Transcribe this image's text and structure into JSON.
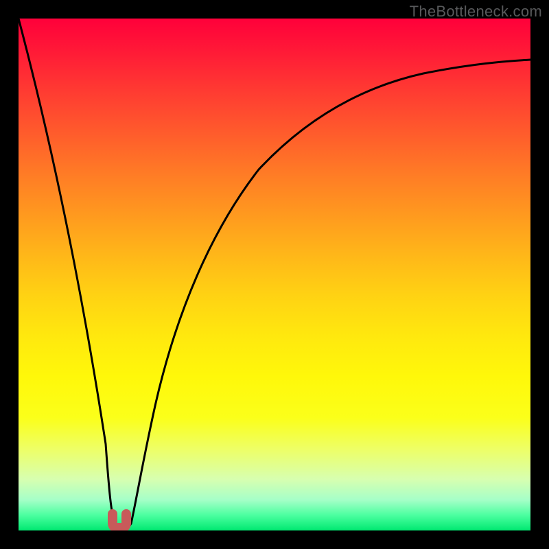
{
  "watermark": "TheBottleneck.com",
  "chart_data": {
    "type": "line",
    "title": "",
    "xlabel": "",
    "ylabel": "",
    "xlim": [
      0,
      100
    ],
    "ylim": [
      0,
      100
    ],
    "series": [
      {
        "name": "bottleneck-curve",
        "x": [
          0,
          2,
          4,
          6,
          8,
          10,
          12,
          14,
          16,
          17,
          18,
          19,
          20,
          21,
          22,
          23,
          24,
          26,
          28,
          30,
          35,
          40,
          45,
          50,
          55,
          60,
          65,
          70,
          75,
          80,
          85,
          90,
          95,
          100
        ],
        "y": [
          100,
          90,
          80,
          69,
          58,
          47,
          36,
          24,
          11,
          5,
          1,
          0,
          0,
          1,
          5,
          11,
          18,
          29,
          38,
          46,
          59,
          67,
          73,
          77,
          80,
          82,
          84,
          85.5,
          87,
          88,
          88.8,
          89.5,
          90.1,
          90.6
        ]
      },
      {
        "name": "your-config",
        "x": [
          18.5,
          20.5
        ],
        "y": [
          1,
          1
        ]
      }
    ],
    "grid": false,
    "legend": false,
    "background_gradient": {
      "top": "#ff003a",
      "bottom": "#00e871",
      "meaning": "red=high bottleneck, green=low bottleneck"
    }
  }
}
